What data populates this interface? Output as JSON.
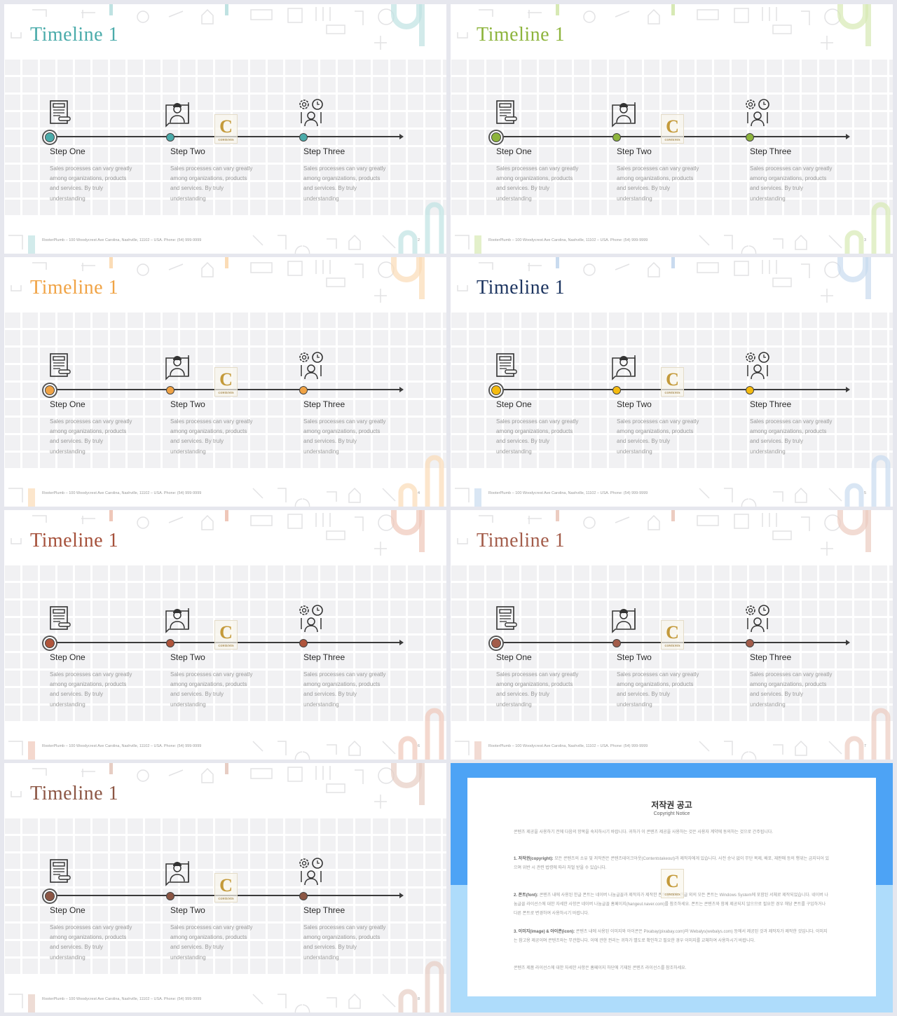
{
  "slides": [
    {
      "title": "Timeline 1",
      "title_color": "#4aabaa",
      "dot_color": "#4aabaa",
      "accent_color": "#bfe2e2",
      "page": "2"
    },
    {
      "title": "Timeline 1",
      "title_color": "#8db43c",
      "dot_color": "#8db43c",
      "accent_color": "#d7e9b4",
      "page": "3"
    },
    {
      "title": "Timeline 1",
      "title_color": "#f0a345",
      "dot_color": "#f0a345",
      "accent_color": "#fbdcb6",
      "page": "4"
    },
    {
      "title": "Timeline 1",
      "title_color": "#1d3560",
      "dot_color": "#f5bb10",
      "accent_color": "#c9dbef",
      "page": "5"
    },
    {
      "title": "Timeline 1",
      "title_color": "#a5503a",
      "dot_color": "#b0553b",
      "accent_color": "#efc7b9",
      "page": "6"
    },
    {
      "title": "Timeline 1",
      "title_color": "#a35c4a",
      "dot_color": "#a35c4a",
      "accent_color": "#ecccc1",
      "page": "7"
    },
    {
      "title": "Timeline 1",
      "title_color": "#8c5644",
      "dot_color": "#8c5644",
      "accent_color": "#e7cdc3",
      "page": "8"
    }
  ],
  "steps": [
    {
      "label": "Step One",
      "icon": "contract-icon",
      "text": [
        "Sales processes can vary greatly",
        "among organizations, products",
        "and services. By truly",
        "understanding"
      ]
    },
    {
      "label": "Step Two",
      "icon": "engineer-blueprint-icon",
      "text": [
        "Sales processes can vary greatly",
        "among organizations, products",
        "and services. By truly",
        "understanding"
      ]
    },
    {
      "label": "Step Three",
      "icon": "gears-clock-worker-icon",
      "text": [
        "Sales processes can vary greatly",
        "among organizations, products",
        "and services. By truly",
        "understanding"
      ]
    }
  ],
  "footer": "RooterPlumb – 100 Woodycrest Ave Carolina, Nashville, 11102 – USA. Phone: (54) 999-9999",
  "watermark": {
    "letter": "C",
    "text": "CONTENTS"
  },
  "copyright": {
    "title": "저작권 공고",
    "subtitle": "Copyright Notice",
    "top_color": "#4da3f5",
    "bottom_color": "#aedcfb",
    "intro": "콘텐츠 제공을 사용하기 전에 다음의 항목을 숙지하시기 바랍니다. 귀하가 이 콘텐츠 제공을 사용하는 것은 사용자 계약에 동의하는 것으로 간주됩니다.",
    "items": [
      {
        "head": "1. 저작권(copyright):",
        "body": "모든 콘텐츠의 소유 및 저작권은 콘텐츠테이크아웃(Contentstakeout)과 제작자에게 있습니다. 사전 승낙 없이 무단 복제, 배포, 재판매 등의 행위는 금지되어 있으며 위반 시 관련 법령에 따라 처벌 받을 수 있습니다."
      },
      {
        "head": "2. 폰트(font):",
        "body": "콘텐츠 내에 사용된 한글 폰트는 네이버 나눔글꼴과 제작자가 제작한 폰트입니다. 한글 외의 모든 폰트는 Windows System에 포함된 서체로 제작되었습니다. 네이버 나눔글꼴 라이선스에 대한 자세한 사항은 네이버 나눔글꼴 홈페이지(hangeul.naver.com)를 참조하세요. 폰트는 콘텐츠와 함께 제공되지 않으므로 필요한 경우 해당 폰트를 구입하거나 다른 폰트로 변경하여 사용하시기 바랍니다."
      },
      {
        "head": "3. 이미지(image) & 아이콘(icon):",
        "body": "콘텐츠 내에 사용된 이미지와 아이콘은 Pixabay(pixabay.com)와 Webalys(webalys.com) 등에서 제공된 것과 제작자가 제작한 것입니다. 이미지는 참고용 제공이며 콘텐츠와는 무관합니다. 이에 관한 권리는 귀하가 별도로 확인하고 필요한 경우 이미지를 교체하여 사용하시기 바랍니다."
      }
    ],
    "outro": "콘텐츠 제품 라이선스에 대한 자세한 사항은 홈페이지 하단에 기재된 콘텐츠 라이선스를 참조하세요."
  }
}
